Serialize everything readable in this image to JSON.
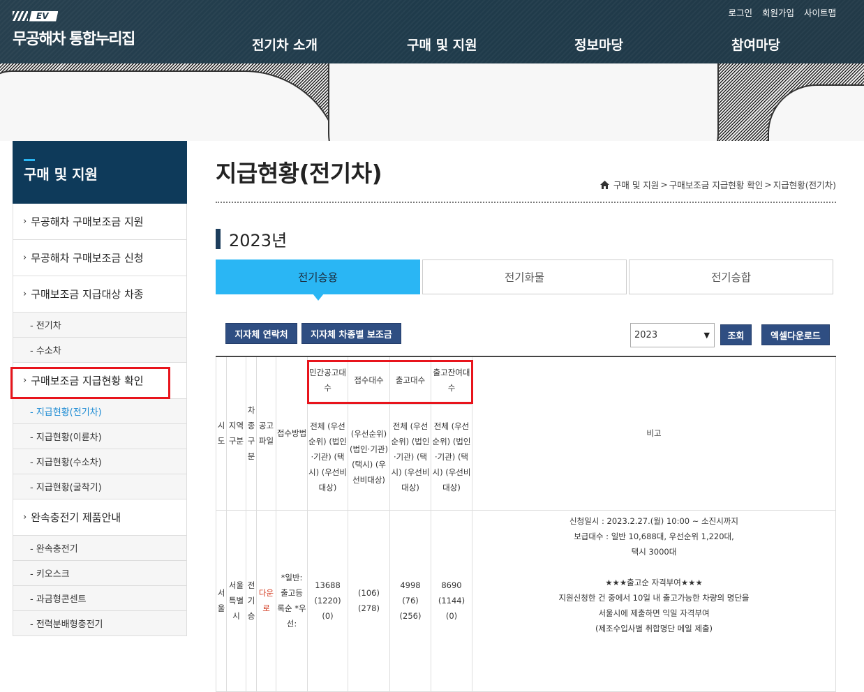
{
  "header": {
    "logo_ev": "EV",
    "logo_text": "무공해차 통합누리집",
    "util": [
      "로그인",
      "회원가입",
      "사이트맵"
    ],
    "gnb": [
      "전기차 소개",
      "구매 및 지원",
      "정보마당",
      "참여마당"
    ]
  },
  "sidebar": {
    "title": "구매 및 지원",
    "menu": [
      {
        "label": "무공해차 구매보조금 지원"
      },
      {
        "label": "무공해차 구매보조금 신청"
      },
      {
        "label": "구매보조금 지급대상 차종"
      },
      {
        "label": "- 전기차"
      },
      {
        "label": "- 수소차"
      },
      {
        "label": "구매보조금 지급현황 확인"
      },
      {
        "label": "- 지급현황(전기차)"
      },
      {
        "label": "- 지급현황(이륜차)"
      },
      {
        "label": "- 지급현황(수소차)"
      },
      {
        "label": "- 지급현황(굴착기)"
      },
      {
        "label": "완속충전기 제품안내"
      },
      {
        "label": "- 완속충전기"
      },
      {
        "label": "- 키오스크"
      },
      {
        "label": "- 과금형콘센트"
      },
      {
        "label": "- 전력분배형충전기"
      }
    ]
  },
  "main": {
    "title": "지급현황(전기차)",
    "breadcrumb": [
      "구매 및 지원",
      "구매보조금 지급현황 확인",
      "지급현황(전기차)"
    ],
    "breadcrumb_sep": ">",
    "year_heading": "2023년",
    "tabs": [
      "전기승용",
      "전기화물",
      "전기승합"
    ],
    "buttons": {
      "contact": "지자체 연락처",
      "subsidy": "지자체 차종별 보조금",
      "search": "조회",
      "excel": "엑셀다운로드"
    },
    "year_select": "2023"
  },
  "table": {
    "headers": {
      "sido": "시도",
      "region": "지역구분",
      "type": "차종구분",
      "notice": "공고파일",
      "method": "접수방법",
      "private_notice": "민간공고대수",
      "received": "접수대수",
      "shipped": "출고대수",
      "remaining": "출고잔여대수",
      "remarks": "비고"
    },
    "subheader": {
      "col1": "전체 (우선순위) (법인·기관) (택시) (우선비대상)",
      "col2": "(우선순위) (법인·기관) (택시) (우선비대상)",
      "col3": "전체 (우선순위) (법인·기관) (택시) (우선비대상)",
      "col4": "전체 (우선순위) (법인·기관) (택시) (우선비대상)"
    },
    "row": {
      "sido": "서울",
      "region": "서울특별시",
      "type": "전기승",
      "notice_link": "다운로",
      "method": "*일반: 출고등 록순 *우선:",
      "private_notice": [
        "13688",
        "(1220)",
        "(0)"
      ],
      "received": [
        "(106)",
        "(278)"
      ],
      "shipped": [
        "4998",
        "(76)",
        "(256)"
      ],
      "remaining": [
        "8690",
        "(1144)",
        "(0)"
      ],
      "remarks": [
        "신청일시 : 2023.2.27.(월) 10:00 ~ 소진시까지",
        "보급대수 : 일반 10,688대, 우선순위 1,220대,",
        "택시 3000대",
        "",
        "★★★출고순 자격부여★★★",
        "지원신청한 건 중에서 10일 내 출고가능한 차량의 명단을",
        "서울시에 제출하면 익일 자격부여",
        "(제조수입사별 취합명단 메일 제출)"
      ]
    }
  }
}
